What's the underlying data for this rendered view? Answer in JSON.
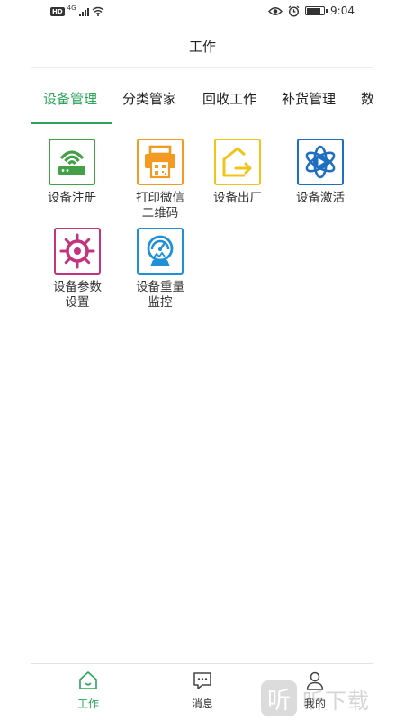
{
  "status_bar": {
    "hd": "HD",
    "network": "4G",
    "time": "9:04",
    "battery_level": 0.9
  },
  "header": {
    "title": "工作"
  },
  "tabs": [
    {
      "label": "设备管理",
      "active": true
    },
    {
      "label": "分类管家",
      "active": false
    },
    {
      "label": "回收工作",
      "active": false
    },
    {
      "label": "补货管理",
      "active": false
    },
    {
      "label": "数",
      "active": false
    }
  ],
  "grid": [
    {
      "label": "设备注册",
      "icon": "router-wifi-icon",
      "color": "#43a047"
    },
    {
      "label": "打印微信\n二维码",
      "icon": "printer-qrcode-icon",
      "color": "#f39a22"
    },
    {
      "label": "设备出厂",
      "icon": "house-exit-icon",
      "color": "#f0c419"
    },
    {
      "label": "设备激活",
      "icon": "atom-play-icon",
      "color": "#1e6fc0"
    },
    {
      "label": "设备参数\n设置",
      "icon": "ship-wheel-icon",
      "color": "#c2357d"
    },
    {
      "label": "设备重量\n监控",
      "icon": "gauge-monitor-icon",
      "color": "#1f8fd6"
    }
  ],
  "bottom_nav": [
    {
      "label": "工作",
      "icon": "home-icon",
      "active": true
    },
    {
      "label": "消息",
      "icon": "message-icon",
      "active": false
    },
    {
      "label": "我的",
      "icon": "profile-icon",
      "active": false
    }
  ],
  "colors": {
    "accent": "#2aa55a",
    "text": "#222222",
    "divider": "#ececec"
  },
  "watermark": {
    "logo": "听",
    "text": "听下载"
  }
}
